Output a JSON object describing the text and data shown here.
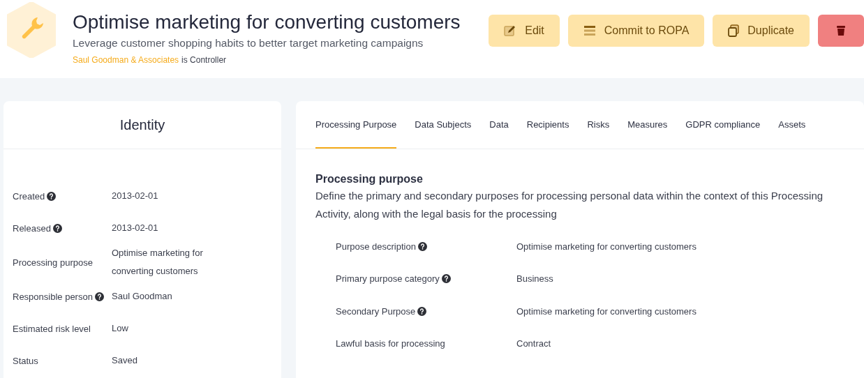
{
  "header": {
    "title": "Optimise marketing for converting customers",
    "subtitle": "Leverage customer shopping habits to better target marketing campaigns",
    "controller_name": "Saul Goodman & Associates",
    "controller_suffix": "is Controller"
  },
  "actions": [
    {
      "kind": "edit",
      "label": "Edit"
    },
    {
      "kind": "commit",
      "label": "Commit to ROPA"
    },
    {
      "kind": "duplicate",
      "label": "Duplicate"
    },
    {
      "kind": "delete"
    }
  ],
  "identity": {
    "title": "Identity",
    "fields": [
      {
        "label": "Created",
        "help": true,
        "value": "2013-02-01"
      },
      {
        "label": "Released",
        "help": true,
        "value": "2013-02-01"
      },
      {
        "label": "Processing purpose",
        "help": false,
        "value": "Optimise marketing for converting customers"
      },
      {
        "label": "Responsible person",
        "help": true,
        "value": "Saul Goodman"
      },
      {
        "label": "Estimated risk level",
        "help": false,
        "value": "Low"
      },
      {
        "label": "Status",
        "help": false,
        "value": "Saved"
      }
    ]
  },
  "tabs": [
    {
      "label": "Processing Purpose",
      "selected": true
    },
    {
      "label": "Data Subjects",
      "selected": false
    },
    {
      "label": "Data",
      "selected": false
    },
    {
      "label": "Recipients",
      "selected": false
    },
    {
      "label": "Risks",
      "selected": false
    },
    {
      "label": "Measures",
      "selected": false
    },
    {
      "label": "GDPR compliance",
      "selected": false
    },
    {
      "label": "Assets",
      "selected": false
    }
  ],
  "section": {
    "title": "Processing purpose",
    "description": "Define the primary and secondary purposes for processing personal data within the context of this Processing Activity, along with the legal basis for the processing",
    "fields": [
      {
        "label": "Purpose description",
        "help": true,
        "value": "Optimise marketing for converting customers"
      },
      {
        "label": "Primary purpose category",
        "help": true,
        "value": "Business"
      },
      {
        "label": "Secondary Purpose",
        "help": true,
        "value": "Optimise marketing for converting customers"
      },
      {
        "label": "Lawful basis for processing",
        "help": false,
        "value": "Contract"
      }
    ]
  }
}
